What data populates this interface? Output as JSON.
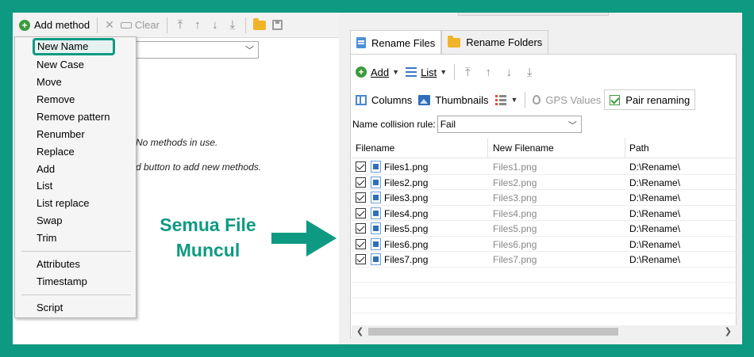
{
  "left_toolbar": {
    "add_method": "Add method",
    "clear": "Clear"
  },
  "left_panel": {
    "message_1": "No methods in use.",
    "message_2": "d button to add new methods."
  },
  "menu": {
    "highlighted": "New Name",
    "group1": [
      "New Case",
      "Move",
      "Remove",
      "Remove pattern",
      "Renumber",
      "Replace",
      "Add",
      "List",
      "List replace",
      "Swap",
      "Trim"
    ],
    "group2": [
      "Attributes",
      "Timestamp"
    ],
    "group3": [
      "Script"
    ]
  },
  "annotation": {
    "line1": "Semua File",
    "line2": "Muncul",
    "color": "#0e9a82"
  },
  "tabs": {
    "rename_files": "Rename Files",
    "rename_folders": "Rename Folders"
  },
  "right_toolbar": {
    "add": "Add",
    "list": "List",
    "columns": "Columns",
    "thumbnails": "Thumbnails",
    "gps_values": "GPS Values",
    "pair_renaming": "Pair renaming"
  },
  "collision": {
    "label": "Name collision rule:",
    "value": "Fail"
  },
  "table": {
    "headers": [
      "Filename",
      "New Filename",
      "Path"
    ],
    "rows": [
      {
        "filename": "Files1.png",
        "new_filename": "Files1.png",
        "path": "D:\\Rename\\"
      },
      {
        "filename": "Files2.png",
        "new_filename": "Files2.png",
        "path": "D:\\Rename\\"
      },
      {
        "filename": "Files3.png",
        "new_filename": "Files3.png",
        "path": "D:\\Rename\\"
      },
      {
        "filename": "Files4.png",
        "new_filename": "Files4.png",
        "path": "D:\\Rename\\"
      },
      {
        "filename": "Files5.png",
        "new_filename": "Files5.png",
        "path": "D:\\Rename\\"
      },
      {
        "filename": "Files6.png",
        "new_filename": "Files6.png",
        "path": "D:\\Rename\\"
      },
      {
        "filename": "Files7.png",
        "new_filename": "Files7.png",
        "path": "D:\\Rename\\"
      }
    ]
  }
}
